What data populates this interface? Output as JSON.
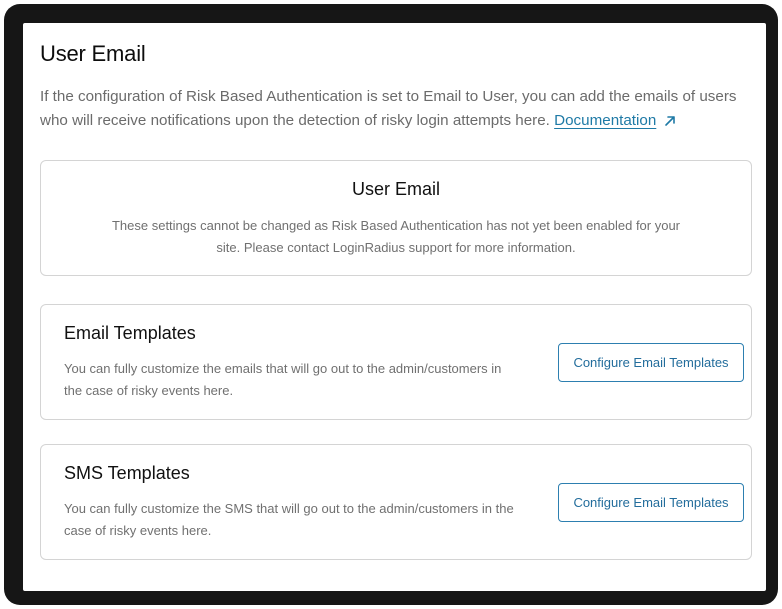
{
  "page": {
    "title": "User Email",
    "intro": "If the configuration of Risk Based Authentication is set to Email to User, you can add the emails of users who will receive notifications upon the detection of risky login attempts here.",
    "doc_link": "Documentation",
    "doc_icon": "external-link-arrow-icon"
  },
  "user_email_card": {
    "title": "User Email",
    "description": "These settings cannot be changed as Risk Based Authentication has not yet been enabled for your site. Please contact LoginRadius support for more information."
  },
  "email_templates_card": {
    "title": "Email Templates",
    "description": "You can fully customize the emails that will go out to the admin/customers in the case of risky events here.",
    "button_label": "Configure Email Templates"
  },
  "sms_templates_card": {
    "title": "SMS Templates",
    "description": "You can fully customize the SMS that will go out to the admin/customers in the case of risky events here.",
    "button_label": "Configure Email Templates"
  },
  "colors": {
    "accent": "#2d7fb0",
    "link": "#1f7aa6",
    "frame": "#161616",
    "border": "#d4d4d4",
    "muted_text": "#707070"
  }
}
